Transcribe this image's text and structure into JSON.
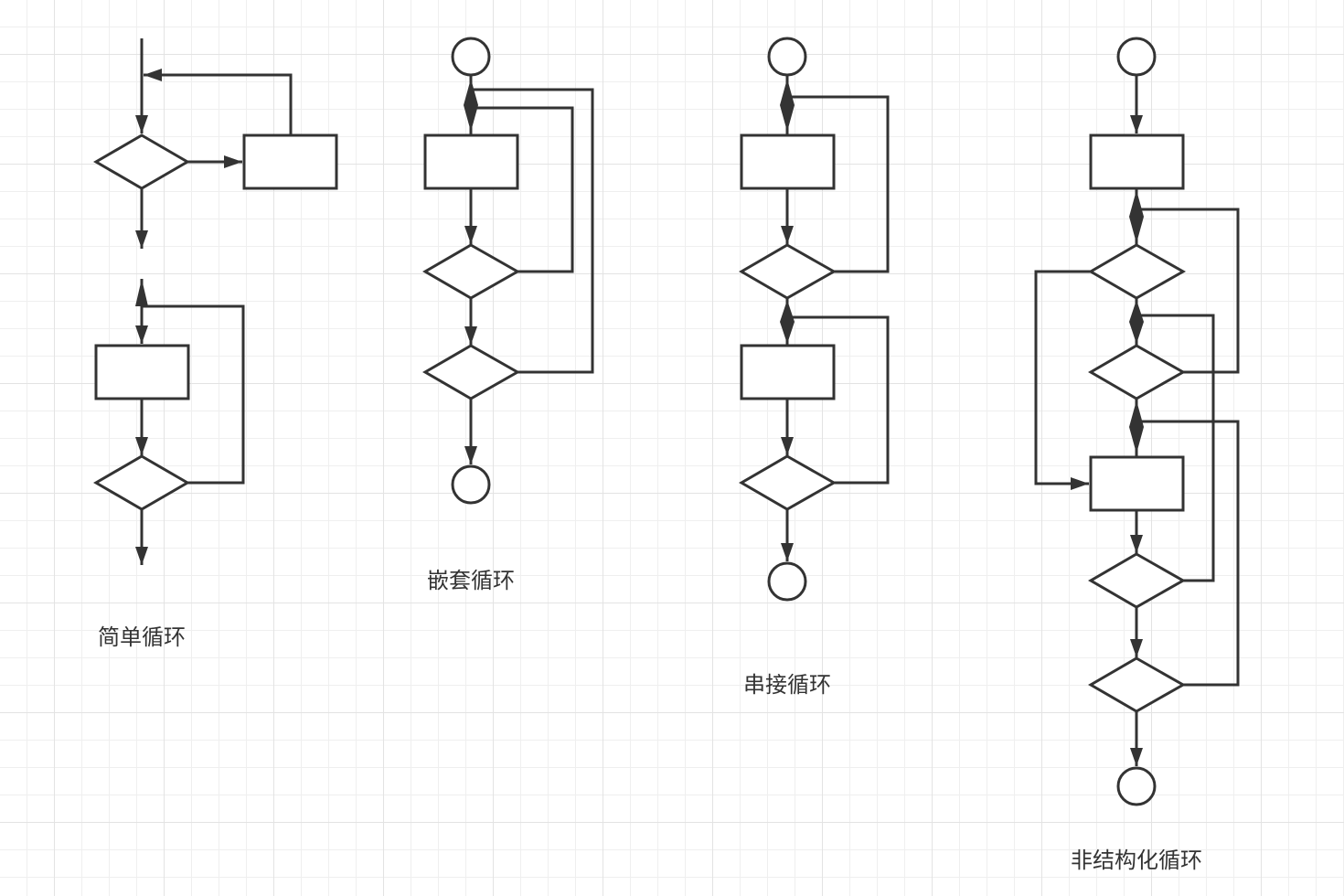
{
  "labels": {
    "simple": "简单循环",
    "nested": "嵌套循环",
    "serial": "串接循环",
    "unstructured": "非结构化循环"
  },
  "colors": {
    "stroke": "#333333",
    "grid": "#ececec",
    "background": "#ffffff"
  }
}
